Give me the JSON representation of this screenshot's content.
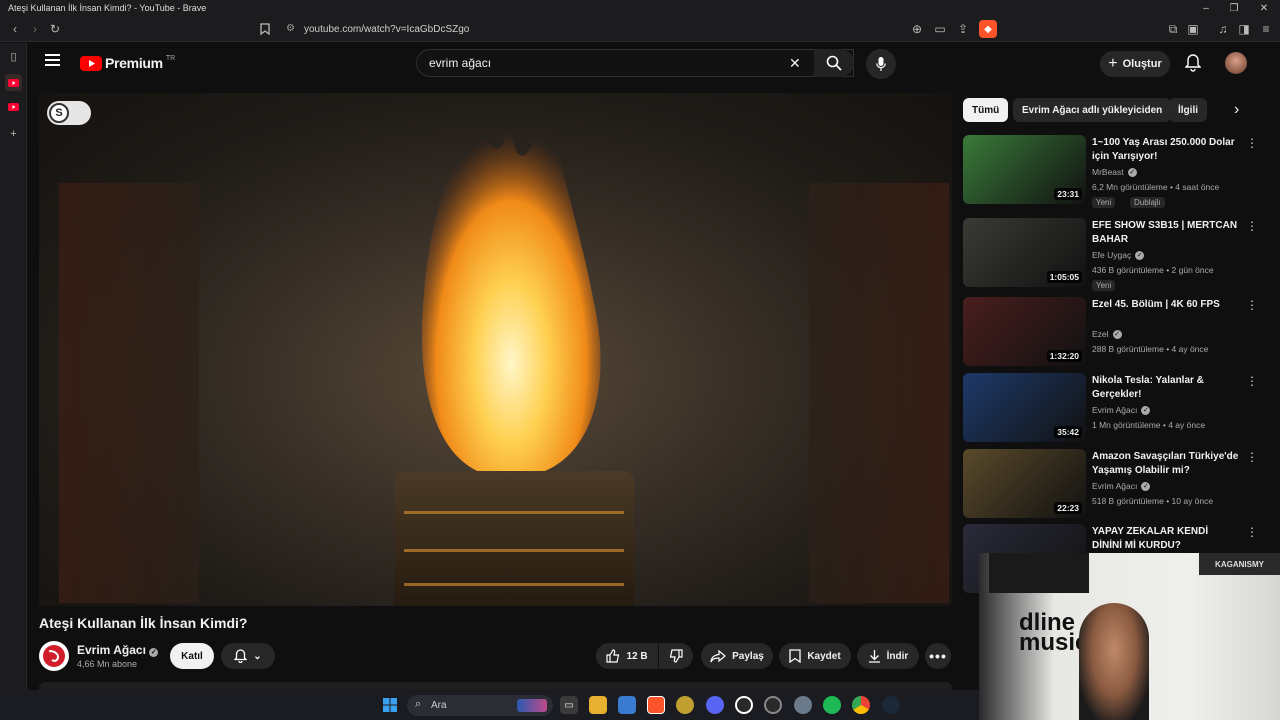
{
  "window": {
    "title": "Ateşi Kullanan İlk İnsan Kimdi? - YouTube - Brave"
  },
  "browser": {
    "url": "youtube.com/watch?v=IcaGbDcSZgo"
  },
  "youtube": {
    "logo_text": "Premium",
    "region": "TR",
    "search_value": "evrim ağacı",
    "create_label": "Oluştur"
  },
  "video": {
    "title": "Ateşi Kullanan İlk İnsan Kimdi?",
    "toggle_letter": "S",
    "channel": "Evrim Ağacı",
    "subscribers": "4,66 Mn abone",
    "join_label": "Katıl",
    "likes": "12 B",
    "share_label": "Paylaş",
    "save_label": "Kaydet",
    "download_label": "İndir"
  },
  "chips": [
    "Tümü",
    "Evrim Ağacı adlı yükleyiciden",
    "İlgili"
  ],
  "recommendations": [
    {
      "title": "1~100 Yaş Arası 250.000 Dolar için Yarışıyor!",
      "channel": "MrBeast",
      "meta": "6,2 Mn görüntüleme • 4 saat önce",
      "duration": "23:31",
      "badges": [
        "Yeni",
        "Dublajlı"
      ],
      "thumb_color": "#3a7a3a"
    },
    {
      "title": "EFE SHOW S3B15 | MERTCAN BAHAR",
      "channel": "Efe Uygaç",
      "meta": "436 B görüntüleme • 2 gün önce",
      "duration": "1:05:05",
      "badges": [
        "Yeni"
      ],
      "thumb_color": "#3b3a35"
    },
    {
      "title": "Ezel 45. Bölüm | 4K 60 FPS",
      "channel": "Ezel",
      "meta": "288 B görüntüleme • 4 ay önce",
      "duration": "1:32:20",
      "badges": [],
      "thumb_color": "#4a1e1e"
    },
    {
      "title": "Nikola Tesla: Yalanlar & Gerçekler!",
      "channel": "Evrim Ağacı",
      "meta": "1 Mn görüntüleme • 4 ay önce",
      "duration": "35:42",
      "badges": [],
      "thumb_color": "#1e3a6a"
    },
    {
      "title": "Amazon Savaşçıları Türkiye'de Yaşamış Olabilir mi?",
      "channel": "Evrim Ağacı",
      "meta": "518 B görüntüleme • 10 ay önce",
      "duration": "22:23",
      "badges": [],
      "thumb_color": "#5a4a2a"
    },
    {
      "title": "YAPAY ZEKALAR KENDİ DİNİNİ Mİ KURDU?",
      "channel": "",
      "meta": "",
      "duration": "",
      "badges": [],
      "thumb_color": "#2a2a3a"
    }
  ],
  "taskbar": {
    "search_label": "Ara"
  },
  "webcam": {
    "wall_text_1": "dline",
    "wall_text_2": "music",
    "poster_text": "KAGANISMY"
  }
}
